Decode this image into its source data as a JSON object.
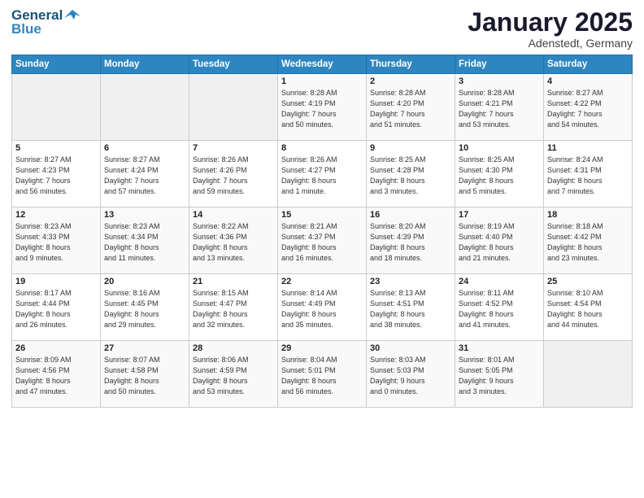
{
  "header": {
    "logo_line1": "General",
    "logo_line2": "Blue",
    "month": "January 2025",
    "location": "Adenstedt, Germany"
  },
  "weekdays": [
    "Sunday",
    "Monday",
    "Tuesday",
    "Wednesday",
    "Thursday",
    "Friday",
    "Saturday"
  ],
  "weeks": [
    [
      {
        "day": "",
        "info": ""
      },
      {
        "day": "",
        "info": ""
      },
      {
        "day": "",
        "info": ""
      },
      {
        "day": "1",
        "info": "Sunrise: 8:28 AM\nSunset: 4:19 PM\nDaylight: 7 hours\nand 50 minutes."
      },
      {
        "day": "2",
        "info": "Sunrise: 8:28 AM\nSunset: 4:20 PM\nDaylight: 7 hours\nand 51 minutes."
      },
      {
        "day": "3",
        "info": "Sunrise: 8:28 AM\nSunset: 4:21 PM\nDaylight: 7 hours\nand 53 minutes."
      },
      {
        "day": "4",
        "info": "Sunrise: 8:27 AM\nSunset: 4:22 PM\nDaylight: 7 hours\nand 54 minutes."
      }
    ],
    [
      {
        "day": "5",
        "info": "Sunrise: 8:27 AM\nSunset: 4:23 PM\nDaylight: 7 hours\nand 56 minutes."
      },
      {
        "day": "6",
        "info": "Sunrise: 8:27 AM\nSunset: 4:24 PM\nDaylight: 7 hours\nand 57 minutes."
      },
      {
        "day": "7",
        "info": "Sunrise: 8:26 AM\nSunset: 4:26 PM\nDaylight: 7 hours\nand 59 minutes."
      },
      {
        "day": "8",
        "info": "Sunrise: 8:26 AM\nSunset: 4:27 PM\nDaylight: 8 hours\nand 1 minute."
      },
      {
        "day": "9",
        "info": "Sunrise: 8:25 AM\nSunset: 4:28 PM\nDaylight: 8 hours\nand 3 minutes."
      },
      {
        "day": "10",
        "info": "Sunrise: 8:25 AM\nSunset: 4:30 PM\nDaylight: 8 hours\nand 5 minutes."
      },
      {
        "day": "11",
        "info": "Sunrise: 8:24 AM\nSunset: 4:31 PM\nDaylight: 8 hours\nand 7 minutes."
      }
    ],
    [
      {
        "day": "12",
        "info": "Sunrise: 8:23 AM\nSunset: 4:33 PM\nDaylight: 8 hours\nand 9 minutes."
      },
      {
        "day": "13",
        "info": "Sunrise: 8:23 AM\nSunset: 4:34 PM\nDaylight: 8 hours\nand 11 minutes."
      },
      {
        "day": "14",
        "info": "Sunrise: 8:22 AM\nSunset: 4:36 PM\nDaylight: 8 hours\nand 13 minutes."
      },
      {
        "day": "15",
        "info": "Sunrise: 8:21 AM\nSunset: 4:37 PM\nDaylight: 8 hours\nand 16 minutes."
      },
      {
        "day": "16",
        "info": "Sunrise: 8:20 AM\nSunset: 4:39 PM\nDaylight: 8 hours\nand 18 minutes."
      },
      {
        "day": "17",
        "info": "Sunrise: 8:19 AM\nSunset: 4:40 PM\nDaylight: 8 hours\nand 21 minutes."
      },
      {
        "day": "18",
        "info": "Sunrise: 8:18 AM\nSunset: 4:42 PM\nDaylight: 8 hours\nand 23 minutes."
      }
    ],
    [
      {
        "day": "19",
        "info": "Sunrise: 8:17 AM\nSunset: 4:44 PM\nDaylight: 8 hours\nand 26 minutes."
      },
      {
        "day": "20",
        "info": "Sunrise: 8:16 AM\nSunset: 4:45 PM\nDaylight: 8 hours\nand 29 minutes."
      },
      {
        "day": "21",
        "info": "Sunrise: 8:15 AM\nSunset: 4:47 PM\nDaylight: 8 hours\nand 32 minutes."
      },
      {
        "day": "22",
        "info": "Sunrise: 8:14 AM\nSunset: 4:49 PM\nDaylight: 8 hours\nand 35 minutes."
      },
      {
        "day": "23",
        "info": "Sunrise: 8:13 AM\nSunset: 4:51 PM\nDaylight: 8 hours\nand 38 minutes."
      },
      {
        "day": "24",
        "info": "Sunrise: 8:11 AM\nSunset: 4:52 PM\nDaylight: 8 hours\nand 41 minutes."
      },
      {
        "day": "25",
        "info": "Sunrise: 8:10 AM\nSunset: 4:54 PM\nDaylight: 8 hours\nand 44 minutes."
      }
    ],
    [
      {
        "day": "26",
        "info": "Sunrise: 8:09 AM\nSunset: 4:56 PM\nDaylight: 8 hours\nand 47 minutes."
      },
      {
        "day": "27",
        "info": "Sunrise: 8:07 AM\nSunset: 4:58 PM\nDaylight: 8 hours\nand 50 minutes."
      },
      {
        "day": "28",
        "info": "Sunrise: 8:06 AM\nSunset: 4:59 PM\nDaylight: 8 hours\nand 53 minutes."
      },
      {
        "day": "29",
        "info": "Sunrise: 8:04 AM\nSunset: 5:01 PM\nDaylight: 8 hours\nand 56 minutes."
      },
      {
        "day": "30",
        "info": "Sunrise: 8:03 AM\nSunset: 5:03 PM\nDaylight: 9 hours\nand 0 minutes."
      },
      {
        "day": "31",
        "info": "Sunrise: 8:01 AM\nSunset: 5:05 PM\nDaylight: 9 hours\nand 3 minutes."
      },
      {
        "day": "",
        "info": ""
      }
    ]
  ]
}
